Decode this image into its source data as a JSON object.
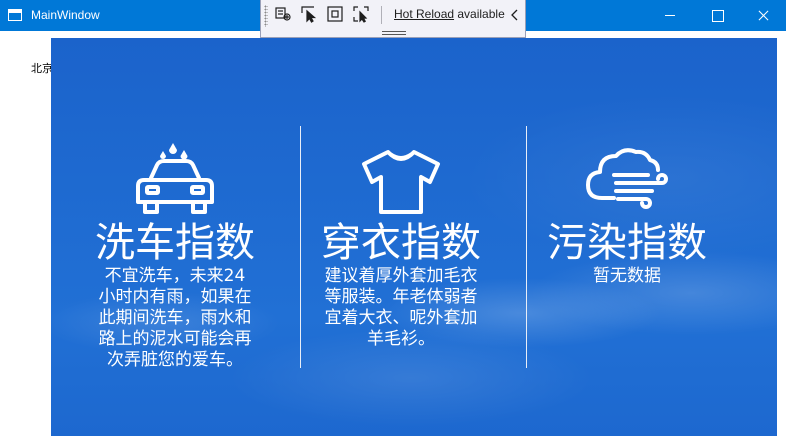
{
  "window": {
    "title": "MainWindow"
  },
  "toolbar": {
    "hot_reload_link": "Hot Reload",
    "hot_reload_status": " available"
  },
  "caption": "北京今天天气指数",
  "indices": [
    {
      "title": "洗车指数",
      "description": "不宜洗车，未来24小时内有雨，如果在此期间洗车，雨水和路上的泥水可能会再次弄脏您的爱车。",
      "icon": "car-wash-icon"
    },
    {
      "title": "穿衣指数",
      "description": "建议着厚外套加毛衣等服装。年老体弱者宜着大衣、呢外套加羊毛衫。",
      "icon": "tshirt-icon"
    },
    {
      "title": "污染指数",
      "description": "暂无数据",
      "icon": "wind-icon"
    }
  ],
  "colors": {
    "titlebar": "#0078d7",
    "panel": "#1f66cc",
    "text": "#ffffff"
  }
}
